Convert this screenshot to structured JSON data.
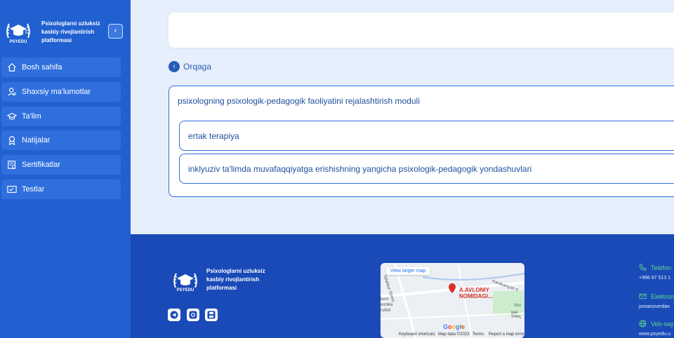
{
  "brand": {
    "logo_caption": "PSYEDU",
    "title": "Psixologlarni uzluksiz kasbiy rivojlantirish platformasi",
    "collapse_icon": "chevron-left"
  },
  "sidebar": {
    "items": [
      {
        "label": "Bosh sahifa",
        "icon": "home-icon"
      },
      {
        "label": "Shaxsiy ma'lumotlar",
        "icon": "user-icon"
      },
      {
        "label": "Ta'lim",
        "icon": "graduation-cap-icon"
      },
      {
        "label": "Natijalar",
        "icon": "award-icon"
      },
      {
        "label": "Sertifikatlar",
        "icon": "certificate-icon"
      },
      {
        "label": "Testlar",
        "icon": "test-icon"
      }
    ]
  },
  "main": {
    "back_label": "Orqaga",
    "module_title": "psixologning psixologik-pedagogik faoliyatini rejalashtirish moduli",
    "sub_items": [
      "ertak terapiya",
      "inklyuziv ta'limda muvafaqqiyatga erishishning yangicha psixologik-pedagogik yondashuvlari"
    ]
  },
  "footer": {
    "logo_caption": "PSYEDU",
    "title": "Psixologlarni uzluksiz kasbiy rivojlantirish platformasi",
    "social": [
      "telegram-icon",
      "instagram-icon",
      "save-icon"
    ],
    "map": {
      "view_larger": "View larger map",
      "place": "A.AVLONIY NOMIDAGI...",
      "street_1": "Tafakkur Street",
      "street_2": "Karakamysh S",
      "district_1": "kent",
      "district_2": "exnika",
      "district_3": "rsiteti",
      "district_4": "Vict",
      "district_5": "yaя Улиц",
      "logo": "Google",
      "shortcuts": "Keyboard shortcuts",
      "map_data": "Map data ©2023",
      "terms": "Terms",
      "report": "Report a map error"
    },
    "contacts": [
      {
        "head": "Telefon",
        "value": "+998 97 513 1",
        "icon": "phone-icon"
      },
      {
        "head": "Elektron",
        "value": "jumanoverdav",
        "icon": "mail-icon"
      },
      {
        "head": "Veb-say",
        "value": "www.psyedu.u",
        "icon": "globe-icon"
      }
    ]
  },
  "colors": {
    "sidebar": "#2160d0",
    "nav_item": "#2f6fdd",
    "footer": "#1a4ab8",
    "accent_text": "#1f4f9e",
    "contact_green": "#5ad68c",
    "background": "#e6effc"
  }
}
